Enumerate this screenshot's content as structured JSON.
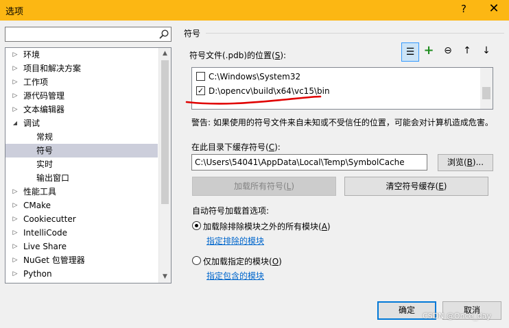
{
  "window": {
    "title": "选项",
    "help_glyph": "?",
    "close_glyph": "✕",
    "title_bar_color": "#fcb713"
  },
  "search": {
    "value": "",
    "placeholder": "",
    "icon": "search-icon"
  },
  "tree": {
    "items": [
      {
        "arrow": "▷",
        "label": "环境",
        "level": 0
      },
      {
        "arrow": "▷",
        "label": "项目和解决方案",
        "level": 0
      },
      {
        "arrow": "▷",
        "label": "工作项",
        "level": 0
      },
      {
        "arrow": "▷",
        "label": "源代码管理",
        "level": 0
      },
      {
        "arrow": "▷",
        "label": "文本编辑器",
        "level": 0
      },
      {
        "arrow": "◢",
        "label": "调试",
        "level": 0
      },
      {
        "arrow": "",
        "label": "常规",
        "level": 1
      },
      {
        "arrow": "",
        "label": "符号",
        "level": 1,
        "selected": true
      },
      {
        "arrow": "",
        "label": "实时",
        "level": 1
      },
      {
        "arrow": "",
        "label": "输出窗口",
        "level": 1
      },
      {
        "arrow": "▷",
        "label": "性能工具",
        "level": 0
      },
      {
        "arrow": "▷",
        "label": "CMake",
        "level": 0
      },
      {
        "arrow": "▷",
        "label": "Cookiecutter",
        "level": 0
      },
      {
        "arrow": "▷",
        "label": "IntelliCode",
        "level": 0
      },
      {
        "arrow": "▷",
        "label": "Live Share",
        "level": 0
      },
      {
        "arrow": "▷",
        "label": "NuGet 包管理器",
        "level": 0
      },
      {
        "arrow": "▷",
        "label": "Python",
        "level": 0
      }
    ],
    "scroll_up": "▲",
    "scroll_down": "▼"
  },
  "panel": {
    "section_title": "符号",
    "symbol_files_label": "符号文件(.pdb)的位置(",
    "symbol_files_key": "S",
    "symbol_files_suffix": "):",
    "toolbar": [
      {
        "name": "new-server-button",
        "glyph": "☰",
        "active": true
      },
      {
        "name": "add-button",
        "glyph": "+",
        "color": "#1e8c1e"
      },
      {
        "name": "remove-button",
        "glyph": "⊖"
      },
      {
        "name": "move-up-button",
        "glyph": "↑"
      },
      {
        "name": "move-down-button",
        "glyph": "↓"
      }
    ],
    "paths": [
      {
        "checked": false,
        "path": "C:\\Windows\\System32"
      },
      {
        "checked": true,
        "path": "D:\\opencv\\build\\x64\\vc15\\bin"
      }
    ],
    "check_glyph": "✓",
    "warning": "警告: 如果使用的符号文件来自未知或不受信任的位置，可能会对计算机造成危害。",
    "cache_label": "在此目录下缓存符号(",
    "cache_key": "C",
    "cache_suffix": "):",
    "cache_path": "C:\\Users\\54041\\AppData\\Local\\Temp\\SymbolCache",
    "browse": {
      "text": "浏览(",
      "key": "B",
      "suffix": ")..."
    },
    "load_all": {
      "text": "加载所有符号(",
      "key": "L",
      "suffix": ")"
    },
    "clear_cache": {
      "text": "清空符号缓存(",
      "key": "E",
      "suffix": ")"
    },
    "auto_load_label": "自动符号加载首选项:",
    "option_all": {
      "text": "加载除排除模块之外的所有模块(",
      "key": "A",
      "suffix": ")",
      "selected": true
    },
    "option_all_link": "指定排除的模块",
    "option_only": {
      "text": "仅加载指定的模块(",
      "key": "O",
      "suffix": ")",
      "selected": false
    },
    "option_only_link": "指定包含的模块",
    "annotation_color": "#e00000"
  },
  "footer": {
    "ok": "确定",
    "cancel": "取消",
    "watermark": "CSDN @Once_day"
  }
}
